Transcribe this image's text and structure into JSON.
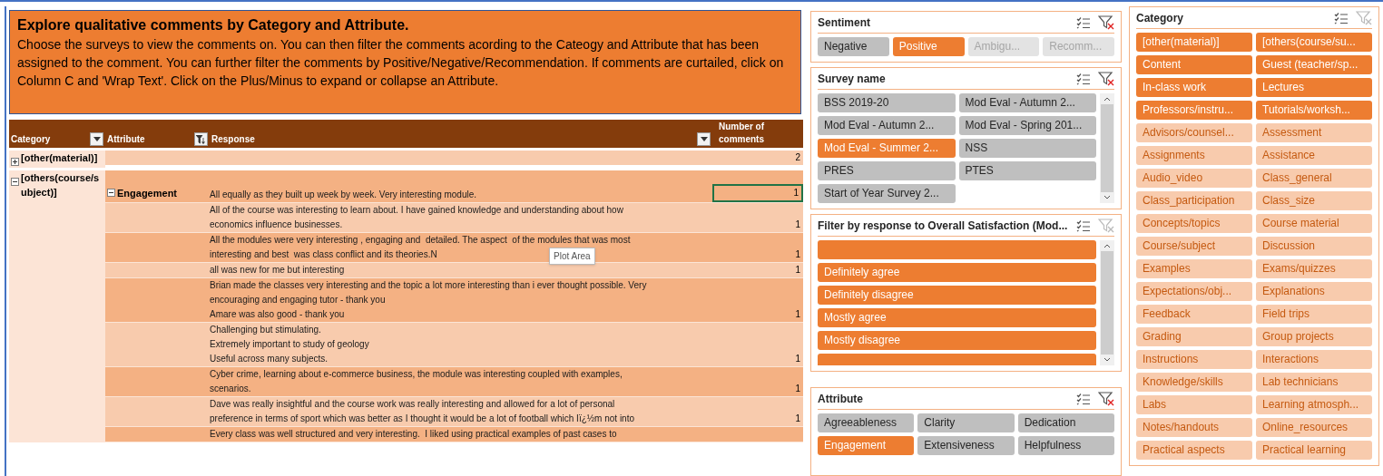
{
  "intro": {
    "title": "Explore qualitative comments by Category and Attribute.",
    "body": "Choose the surveys to view the comments on. You can then filter the comments acording to the Cateogy and Attribute that has been assigned to the comment. You can further filter the comments by Positive/Negative/Recommendation. If comments are curtailed, click on Column C and 'Wrap Text'. Click on the Plus/Minus to expand or collapse an Attribute."
  },
  "pivot": {
    "columns": [
      {
        "label": "Category",
        "kind": "dropdown"
      },
      {
        "label": "Attribute",
        "kind": "filter"
      },
      {
        "label": "Response",
        "kind": "dropdown"
      },
      {
        "label": "Number of comments",
        "kind": "plain"
      }
    ],
    "groups": [
      {
        "category": "[other(material)]",
        "expanded": false,
        "total": "2"
      },
      {
        "category": "[others(course/subject)]",
        "expanded": true,
        "attributes": [
          {
            "name": "Engagement",
            "expanded": true,
            "rows": [
              {
                "lines": [
                  "All equally as they built up week by week. Very interesting module."
                ],
                "count": "1",
                "active": true
              },
              {
                "lines": [
                  "All of the course was interesting to learn about. I have gained knowledge and understanding about how",
                  "economics influence businesses."
                ],
                "count": "1",
                "active": false
              },
              {
                "lines": [
                  "All the modules were very interesting , engaging and  detailed. The aspect  of the modules that was most",
                  "interesting and best  was class conflict and its theories.N"
                ],
                "count": "1",
                "active": false
              },
              {
                "lines": [
                  "all was new for me but interesting"
                ],
                "count": "1",
                "active": false
              },
              {
                "lines": [
                  "Brian made the classes very interesting and the topic a lot more interesting than i ever thought possible. Very",
                  "encouraging and engaging tutor - thank you",
                  "Amare was also good - thank you"
                ],
                "count": "1",
                "active": false
              },
              {
                "lines": [
                  "Challenging but stimulating.",
                  "Extremely important to study of geology",
                  "Useful across many subjects."
                ],
                "count": "1",
                "active": false
              },
              {
                "lines": [
                  "Cyber crime, learning about e-commerce business, the module was interesting coupled with examples,",
                  "scenarios."
                ],
                "count": "1",
                "active": false
              },
              {
                "lines": [
                  "Dave was really insightful and the course work was really interesting and allowed for a lot of personal",
                  "preference in terms of sport which was better as I thought it would be a lot of football which Iï¿½m not into"
                ],
                "count": "1",
                "active": false
              },
              {
                "lines": [
                  "Every class was well structured and very interesting.  I liked using practical examples of past cases to"
                ],
                "active": false
              }
            ]
          }
        ]
      }
    ]
  },
  "tooltip": "Plot Area",
  "slicers_middle": [
    {
      "title": "Sentiment",
      "filtered": true,
      "items": [
        {
          "label": "Negative",
          "selected": false,
          "available": true
        },
        {
          "label": "Positive",
          "selected": true,
          "available": true
        },
        {
          "label": "Ambigu...",
          "selected": false,
          "available": false
        },
        {
          "label": "Recomm...",
          "selected": false,
          "available": false
        }
      ]
    },
    {
      "title": "Survey name",
      "filtered": true,
      "scroll": true,
      "items": [
        {
          "label": "BSS 2019-20",
          "selected": false
        },
        {
          "label": "Mod Eval - Autumn 2...",
          "selected": false
        },
        {
          "label": "Mod Eval - Autumn 2...",
          "selected": false
        },
        {
          "label": "Mod Eval - Spring 201...",
          "selected": false
        },
        {
          "label": "Mod Eval - Summer 2...",
          "selected": true
        },
        {
          "label": "NSS",
          "selected": false
        },
        {
          "label": "PRES",
          "selected": false
        },
        {
          "label": "PTES",
          "selected": false
        },
        {
          "label": "Start of Year Survey 2...",
          "selected": false
        }
      ]
    },
    {
      "title": "Filter by response to Overall Satisfaction (Mod...",
      "filtered": false,
      "scroll": true,
      "items": [
        {
          "selected": true
        },
        {
          "label": "Definitely agree",
          "selected": true
        },
        {
          "label": "Definitely disagree",
          "selected": true
        },
        {
          "label": "Mostly agree",
          "selected": true
        },
        {
          "label": "Mostly disagree",
          "selected": true
        },
        {
          "selected": true
        }
      ]
    },
    {
      "title": "Attribute",
      "filtered": true,
      "items": [
        {
          "label": "Agreeableness",
          "selected": false
        },
        {
          "label": "Clarity",
          "selected": false
        },
        {
          "label": "Dedication",
          "selected": false
        },
        {
          "label": "Engagement",
          "selected": true
        },
        {
          "label": "Extensiveness",
          "selected": false
        },
        {
          "label": "Helpfulness",
          "selected": false
        }
      ]
    }
  ],
  "slicer_right": {
    "title": "Category",
    "filtered": false,
    "items": [
      {
        "label": "[other(material)]",
        "selected": true
      },
      {
        "label": "[others(course/su...",
        "selected": true
      },
      {
        "label": "Content",
        "selected": true
      },
      {
        "label": "Guest (teacher/sp...",
        "selected": true
      },
      {
        "label": "In-class work",
        "selected": true
      },
      {
        "label": "Lectures",
        "selected": true
      },
      {
        "label": "Professors/instru...",
        "selected": true
      },
      {
        "label": "Tutorials/worksh...",
        "selected": true
      },
      {
        "label": "Advisors/counsel...",
        "selected": false
      },
      {
        "label": "Assessment",
        "selected": false
      },
      {
        "label": "Assignments",
        "selected": false
      },
      {
        "label": "Assistance",
        "selected": false
      },
      {
        "label": "Audio_video",
        "selected": false
      },
      {
        "label": "Class_general",
        "selected": false
      },
      {
        "label": "Class_participation",
        "selected": false
      },
      {
        "label": "Class_size",
        "selected": false
      },
      {
        "label": "Concepts/topics",
        "selected": false
      },
      {
        "label": "Course material",
        "selected": false
      },
      {
        "label": "Course/subject",
        "selected": false
      },
      {
        "label": "Discussion",
        "selected": false
      },
      {
        "label": "Examples",
        "selected": false
      },
      {
        "label": "Exams/quizzes",
        "selected": false
      },
      {
        "label": "Expectations/obj...",
        "selected": false
      },
      {
        "label": "Explanations",
        "selected": false
      },
      {
        "label": "Feedback",
        "selected": false
      },
      {
        "label": "Field trips",
        "selected": false
      },
      {
        "label": "Grading",
        "selected": false
      },
      {
        "label": "Group projects",
        "selected": false
      },
      {
        "label": "Instructions",
        "selected": false
      },
      {
        "label": "Interactions",
        "selected": false
      },
      {
        "label": "Knowledge/skills",
        "selected": false
      },
      {
        "label": "Lab technicians",
        "selected": false
      },
      {
        "label": "Labs",
        "selected": false
      },
      {
        "label": "Learning atmosph...",
        "selected": false
      },
      {
        "label": "Notes/handouts",
        "selected": false
      },
      {
        "label": "Online_resources",
        "selected": false
      },
      {
        "label": "Practical aspects",
        "selected": false
      },
      {
        "label": "Practical learning",
        "selected": false
      }
    ]
  }
}
